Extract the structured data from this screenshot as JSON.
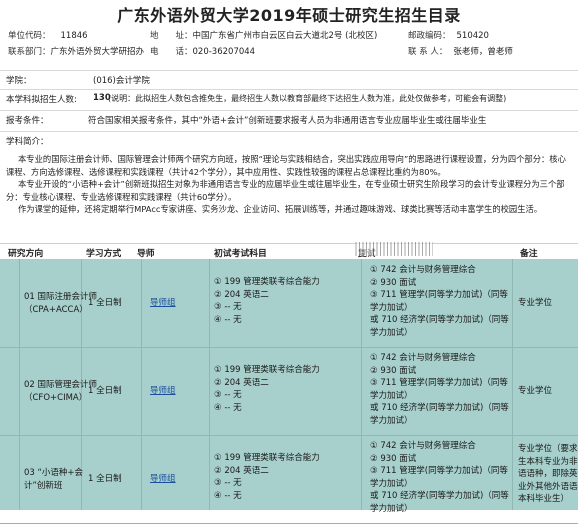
{
  "title": "广东外语外贸大学2019年硕士研究生招生目录",
  "info": {
    "school_code_label": "单位代码：",
    "school_code": "11846",
    "address_label": "地　　址：",
    "address": "中国广东省广州市白云区白云大道北2号 (北校区)",
    "postcode_label": "邮政编码：",
    "postcode": "510420",
    "dept_label": "联系部门：",
    "dept": "广东外语外贸大学研招办",
    "phone_label": "电　　话：",
    "phone": "020-36207044",
    "contact_label": "联 系 人：",
    "contact": "张老师，曾老师"
  },
  "college": {
    "label": "学院：",
    "value": "(016)会计学院"
  },
  "plan": {
    "label": "本学科拟招生人数:",
    "value": "130",
    "note": "(说明：此拟招生人数包含推免生，最终招生人数以教育部最终下达招生人数为准，此处仅做参考，可能会有调整)"
  },
  "requirement": {
    "label": "报考条件：",
    "value": "符合国家相关报考条件，其中“外语+会计”创新班要求报考人员为非通用语言专业应届毕业生或往届毕业生"
  },
  "intro": {
    "label": "学科简介：",
    "p1": "本专业的国际注册会计师、国际管理会计师两个研究方向班，按照“理论与实践相结合，突出实践应用导向”的思路进行课程设置，分为四个部分：核心课程、方向选修课程、选修课程和实践课程（共计42个学分），其中应用性、实践性较强的课程占总课程比重约为80%。",
    "p2": "本专业开设的“小语种+会计”创新班拟招生对象为非通用语言专业的应届毕业生或往届毕业生，在专业硕士研究生阶段学习的会计专业课程分为三个部分：专业核心课程、专业选修课程和实践课程（共计60学分）。",
    "p3": "作为课堂的延伸，还将定期举行MPAcc专家讲座、实务沙龙、企业访问、拓展训练等，并通过趣味游戏、球类比赛等活动丰富学生的校园生活。"
  },
  "table": {
    "headers": {
      "direction": "研究方向",
      "mode": "学习方式",
      "tutor": "导师",
      "exam": "初试考试科目",
      "retest": "复试",
      "note": "备注"
    },
    "rows": [
      {
        "direction_1": "01 国际注册会计师",
        "direction_2": "（CPA+ACCA）",
        "mode": "1 全日制",
        "tutor": "导师组",
        "exam": [
          "① 199 管理类联考综合能力",
          "② 204 英语二",
          "③ -- 无",
          "④ -- 无"
        ],
        "retest": [
          "① 742 会计与财务管理综合",
          "② 930 面试",
          "③ 711 管理学(同等学力加试)（同等",
          "学力加试）",
          "或 710 经济学(同等学力加试)（同等",
          "学力加试）"
        ],
        "note": [
          "专业学位"
        ]
      },
      {
        "direction_1": "02 国际管理会计师",
        "direction_2": "（CFO+CIMA）",
        "mode": "1 全日制",
        "tutor": "导师组",
        "exam": [
          "① 199 管理类联考综合能力",
          "② 204 英语二",
          "③ -- 无",
          "④ -- 无"
        ],
        "retest": [
          "① 742 会计与财务管理综合",
          "② 930 面试",
          "③ 711 管理学(同等学力加试)（同等",
          "学力加试）",
          "或 710 经济学(同等学力加试)（同等",
          "学力加试）"
        ],
        "note": [
          "专业学位"
        ]
      },
      {
        "direction_1": "03 “小语种+会",
        "direction_2": "计”创新班",
        "mode": "1 全日制",
        "tutor": "导师组",
        "exam": [
          "① 199 管理类联考综合能力",
          "② 204 英语二",
          "③ -- 无",
          "④ -- 无"
        ],
        "retest": [
          "① 742 会计与财务管理综合",
          "② 930 面试",
          "③ 711 管理学(同等学力加试)（同等",
          "学力加试）",
          "或 710 经济学(同等学力加试)（同等",
          "学力加试）"
        ],
        "note": [
          "专业学位（要求考",
          "生本科专业为非通用",
          "语语种，即除英语",
          "业外其他外语语种",
          "本科毕业生）"
        ]
      }
    ]
  },
  "colors": {
    "table_bg": "#a7cfcb",
    "link": "#1a4fa0"
  }
}
